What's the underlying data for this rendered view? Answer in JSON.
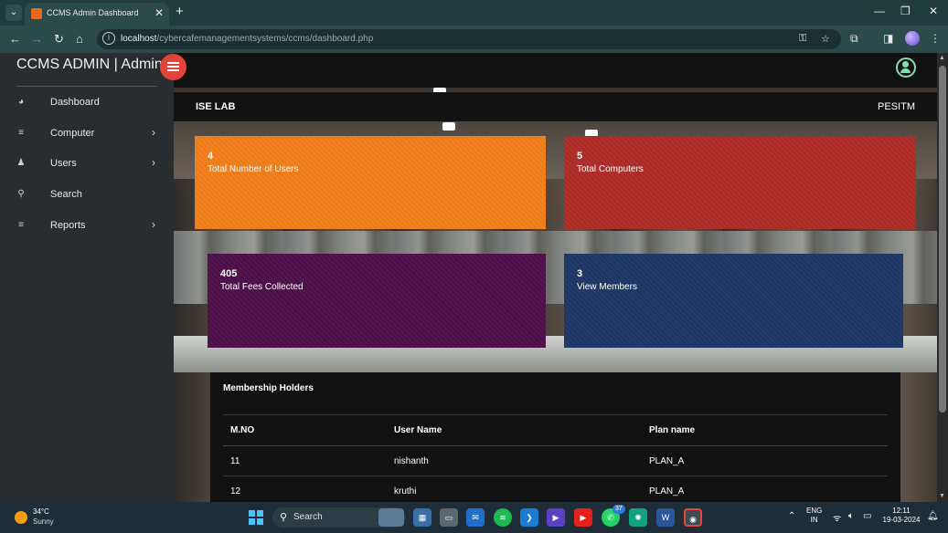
{
  "browser": {
    "tab_title": "CCMS Admin Dashboard",
    "url_host": "localhost",
    "url_path": "/cybercafemanagementsystems/ccms/dashboard.php"
  },
  "sidebar": {
    "brand": "CCMS ADMIN | Admin",
    "items": [
      {
        "label": "Dashboard",
        "icon": "dashboard-icon",
        "has_submenu": false
      },
      {
        "label": "Computer",
        "icon": "list-icon",
        "has_submenu": true
      },
      {
        "label": "Users",
        "icon": "user-icon",
        "has_submenu": true
      },
      {
        "label": "Search",
        "icon": "search-icon",
        "has_submenu": false
      },
      {
        "label": "Reports",
        "icon": "list-icon",
        "has_submenu": true
      }
    ]
  },
  "header": {
    "lab_name": "ISE LAB",
    "organization": "PESITM"
  },
  "cards": [
    {
      "value": "4",
      "label": "Total Number of Users",
      "color": "#ef7d1e"
    },
    {
      "value": "5",
      "label": "Total Computers",
      "color": "#ad2e29"
    },
    {
      "value": "405",
      "label": "Total Fees Collected",
      "color": "#4e124a"
    },
    {
      "value": "3",
      "label": "View Members",
      "color": "#1f3865"
    }
  ],
  "membership": {
    "title": "Membership Holders",
    "columns": [
      "M.NO",
      "User Name",
      "Plan name"
    ],
    "rows": [
      [
        "11",
        "nishanth",
        "PLAN_A"
      ],
      [
        "12",
        "kruthi",
        "PLAN_A"
      ]
    ]
  },
  "taskbar": {
    "temperature": "34°C",
    "condition": "Sunny",
    "search_label": "Search",
    "language_line1": "ENG",
    "language_line2": "IN",
    "time": "12:11",
    "date": "19-03-2024",
    "chat_badge": "37"
  },
  "colors": {
    "accent_red": "#e2433a",
    "user_icon": "#7be3b3"
  }
}
